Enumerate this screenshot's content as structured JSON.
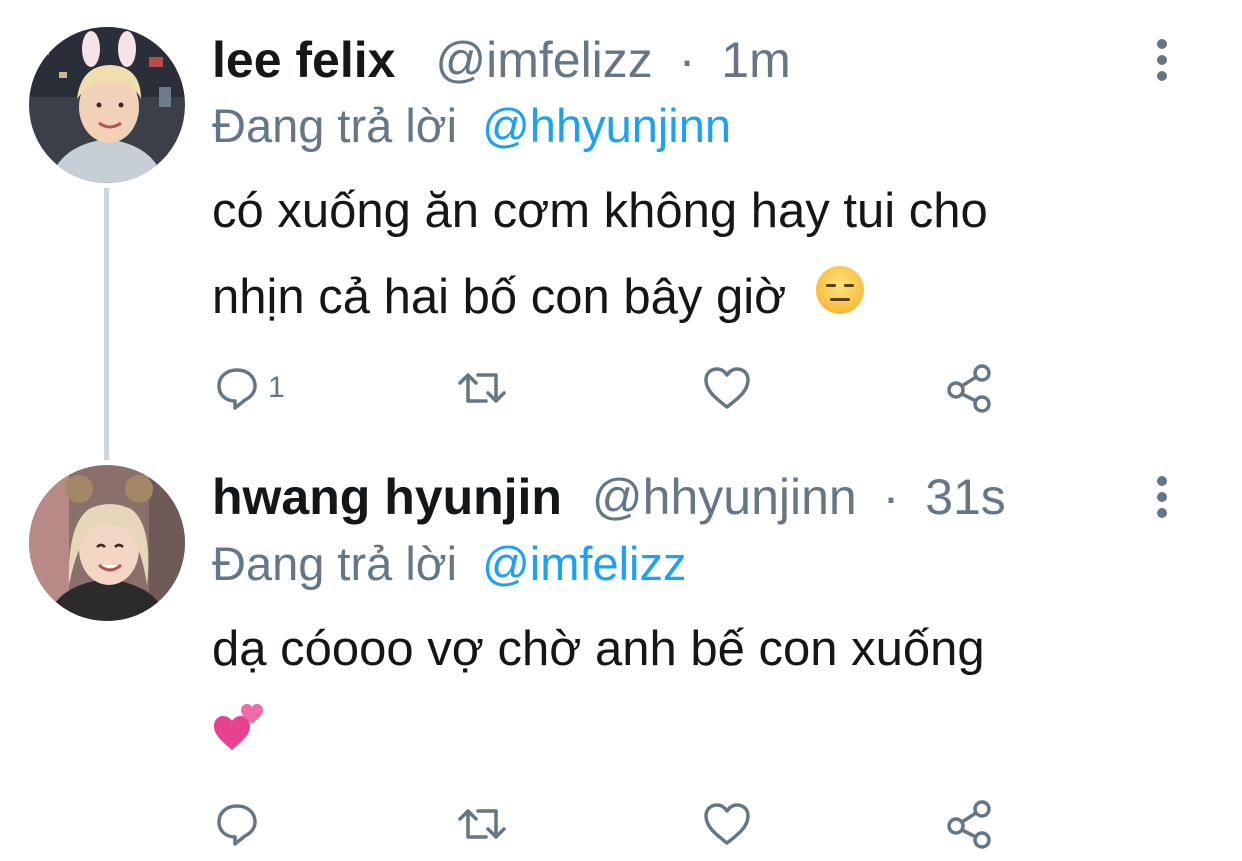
{
  "tweets": [
    {
      "name": "lee felix",
      "handle": "@imfelizz",
      "separator": "·",
      "time": "1m",
      "reply_prefix": "Đang trả lời",
      "reply_to": "@hhyunjinn",
      "text_line1": "có xuống ăn cơm không hay tui cho",
      "text_line2": "nhịn cả hai bố con bây giờ",
      "emoji": "expressionless-face",
      "reply_count": "1"
    },
    {
      "name": "hwang hyunjin",
      "handle": "@hhyunjinn",
      "separator": "·",
      "time": "31s",
      "reply_prefix": "Đang trả lời",
      "reply_to": "@imfelizz",
      "text_line1": "dạ cóooo vợ chờ anh bế con xuống",
      "emoji": "two-hearts",
      "reply_count": ""
    }
  ],
  "icons": {
    "reply": "reply-bubble-icon",
    "retweet": "retweet-icon",
    "like": "heart-icon",
    "share": "share-icon",
    "more": "more-vertical-icon"
  },
  "colors": {
    "text": "#14171a",
    "secondary": "#657786",
    "mention": "#1da1f2",
    "thread_line": "#ccd6dd"
  }
}
